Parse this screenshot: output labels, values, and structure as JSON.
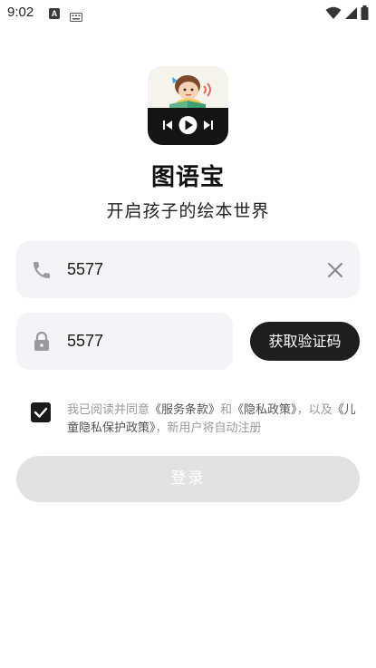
{
  "status_bar": {
    "time": "9:02",
    "input_badge": "A",
    "icons": [
      "wifi-icon",
      "signal-icon",
      "battery-icon"
    ]
  },
  "app": {
    "title": "图语宝",
    "subtitle": "开启孩子的绘本世界"
  },
  "phone_field": {
    "value": "5577",
    "icon": "phone-icon",
    "clear_icon": "close-icon"
  },
  "code_field": {
    "value": "5577",
    "icon": "lock-icon"
  },
  "code_button": {
    "label": "获取验证码"
  },
  "agreement": {
    "checked": true,
    "prefix": "我已阅读并同意",
    "terms_link": "《服务条款》",
    "and": "和",
    "privacy_link": "《隐私政策》",
    "also": "，以及",
    "child_privacy_link": "《儿童隐私保护政策》",
    "suffix": "，新用户将自动注册"
  },
  "login_button": {
    "label": "登录"
  },
  "colors": {
    "accent": "#1e1e1e",
    "field_bg": "#f3f3f8",
    "disabled_button": "#e2e2e4"
  }
}
